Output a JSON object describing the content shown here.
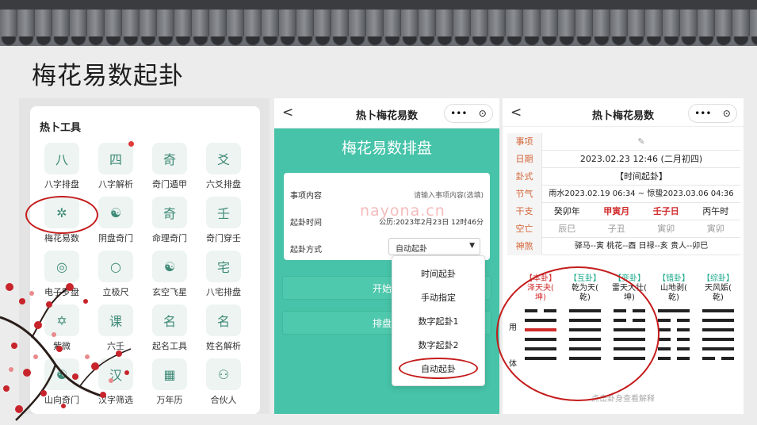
{
  "title": "梅花易数起卦",
  "panel1": {
    "header": "热卜工具",
    "tools": [
      {
        "label": "八字排盘",
        "icon": "bazi-icon",
        "glyph": "八"
      },
      {
        "label": "八字解析",
        "icon": "bazi-analysis-icon",
        "glyph": "四",
        "badge": true
      },
      {
        "label": "奇门遁甲",
        "icon": "qimen-icon",
        "glyph": "奇"
      },
      {
        "label": "六爻排盘",
        "icon": "liuyao-icon",
        "glyph": "爻"
      },
      {
        "label": "梅花易数",
        "icon": "plum-blossom-icon",
        "glyph": "✲"
      },
      {
        "label": "阴盘奇门",
        "icon": "yin-yang-icon",
        "glyph": "☯"
      },
      {
        "label": "命理奇门",
        "icon": "qimen-fate-icon",
        "glyph": "奇"
      },
      {
        "label": "奇门穿壬",
        "icon": "ren-icon",
        "glyph": "壬"
      },
      {
        "label": "电子罗盘",
        "icon": "compass-icon",
        "glyph": "◎"
      },
      {
        "label": "立极尺",
        "icon": "ruler-circle-icon",
        "glyph": "○"
      },
      {
        "label": "玄空飞星",
        "icon": "flying-star-icon",
        "glyph": "☯"
      },
      {
        "label": "八宅排盘",
        "icon": "house-icon",
        "glyph": "宅"
      },
      {
        "label": "紫微",
        "icon": "ziwei-icon",
        "glyph": "✡"
      },
      {
        "label": "六壬",
        "icon": "liuren-icon",
        "glyph": "课"
      },
      {
        "label": "起名工具",
        "icon": "naming-icon",
        "glyph": "名"
      },
      {
        "label": "姓名解析",
        "icon": "name-analysis-icon",
        "glyph": "名"
      },
      {
        "label": "山向奇门",
        "icon": "mountain-icon",
        "glyph": "☯"
      },
      {
        "label": "汉字筛选",
        "icon": "hanzi-icon",
        "glyph": "汉"
      },
      {
        "label": "万年历",
        "icon": "calendar-icon",
        "glyph": "▦"
      },
      {
        "label": "合伙人",
        "icon": "partner-icon",
        "glyph": "⚇"
      }
    ]
  },
  "panel2": {
    "nav_title": "热卜梅花易数",
    "back": "<",
    "more": "•••",
    "record": "⊙",
    "heading": "梅花易数排盘",
    "field_label_1": "事项内容",
    "field_placeholder_1": "请输入事项内容(选填)",
    "field_label_2": "起卦时间",
    "field_value_2": "公历:2023年2月23日 12时46分",
    "field_label_3": "起卦方式",
    "select_value": "自动起卦",
    "caret": "▼",
    "watermark": "nayona.cn",
    "button_1": "开始排",
    "button_2": "排盘记",
    "menu": [
      "时间起卦",
      "手动指定",
      "数字起卦1",
      "数字起卦2",
      "自动起卦"
    ]
  },
  "panel3": {
    "nav_title": "热卜梅花易数",
    "back": "<",
    "more": "•••",
    "record": "⊙",
    "rows": {
      "shixiang": {
        "label": "事项",
        "value": "✎"
      },
      "riqi": {
        "label": "日期",
        "value": "2023.02.23 12:46 (二月初四)"
      },
      "guashi": {
        "label": "卦式",
        "value": "【时间起卦】"
      },
      "jieqi": {
        "label": "节气",
        "value": "雨水2023.02.19 06:34 ~ 惊蛰2023.03.06 04:36"
      },
      "ganzhi": {
        "label": "干支",
        "cells": [
          "癸卯年",
          "甲寅月",
          "壬子日",
          "丙午时"
        ]
      },
      "kongwang": {
        "label": "空亡",
        "cells": [
          "辰巳",
          "子丑",
          "寅卯",
          "寅卯"
        ]
      },
      "shensha": {
        "label": "神煞",
        "value": "驿马--寅  桃花--酉  日禄--亥  贵人--卯巳"
      }
    },
    "guas": [
      {
        "tag": "【本卦】",
        "name": "泽天夬(",
        "palace": "坤)"
      },
      {
        "tag": "【互卦】",
        "name": "乾为天(",
        "palace": "乾)"
      },
      {
        "tag": "【变卦】",
        "name": "雷天大壮(",
        "palace": "坤)"
      },
      {
        "tag": "【错卦】",
        "name": "山地剥(",
        "palace": "乾)"
      },
      {
        "tag": "【综卦】",
        "name": "天风姤(",
        "palace": "乾)"
      }
    ],
    "yong": "用",
    "ti": "体",
    "hint": "点击卦身查看解释"
  }
}
